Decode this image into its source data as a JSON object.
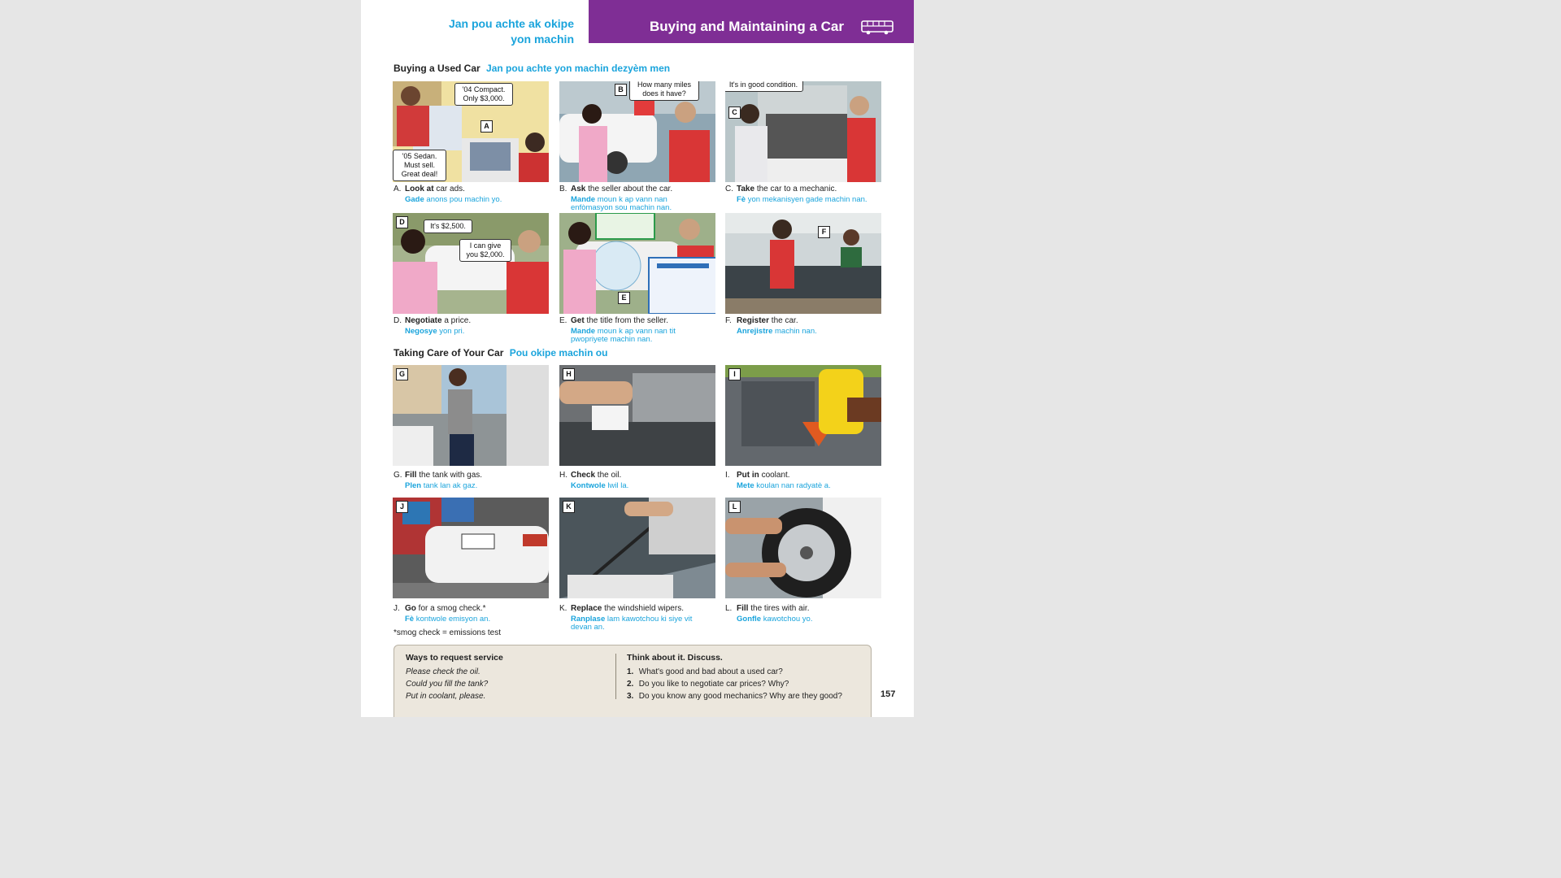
{
  "header": {
    "ht_title_1": "Jan pou achte ak okipe",
    "ht_title_2": "yon machin",
    "title": "Buying and Maintaining a Car"
  },
  "sections": [
    {
      "title": "Buying a Used Car",
      "ht": "Jan pou achte yon machin dezyèm men"
    },
    {
      "title": "Taking Care of Your Car",
      "ht": "Pou okipe machin ou"
    }
  ],
  "items": [
    {
      "letter": "A",
      "verb": "Look at",
      "rest": "car ads.",
      "ht_verb": "Gade",
      "ht_rest": "anons pou machin yo.",
      "bubbles": [
        "'04 Compact. Only $3,000.",
        "'05 Sedan. Must sell. Great deal!"
      ]
    },
    {
      "letter": "B",
      "verb": "Ask",
      "rest": "the seller about the car.",
      "ht_verb": "Mande",
      "ht_rest": "moun k ap vann nan enfòmasyon sou machin nan.",
      "bubbles": [
        "How many miles does it have?"
      ]
    },
    {
      "letter": "C",
      "verb": "Take",
      "rest": "the car to a mechanic.",
      "ht_verb": "Fè",
      "ht_rest": "yon mekanisyen gade machin nan.",
      "bubbles": [
        "It's in good condition."
      ]
    },
    {
      "letter": "D",
      "verb": "Negotiate",
      "rest": "a price.",
      "ht_verb": "Negosye",
      "ht_rest": "yon pri.",
      "bubbles": [
        "It's $2,500.",
        "I can give you $2,000."
      ]
    },
    {
      "letter": "E",
      "verb": "Get",
      "rest": "the title from the seller.",
      "ht_verb": "Mande",
      "ht_rest": "moun k ap vann nan tit pwopriyete machin nan.",
      "bubbles": []
    },
    {
      "letter": "F",
      "verb": "Register",
      "rest": "the car.",
      "ht_verb": "Anrejistre",
      "ht_rest": "machin nan.",
      "bubbles": []
    },
    {
      "letter": "G",
      "verb": "Fill",
      "rest": "the tank with gas.",
      "ht_verb": "Plen",
      "ht_rest": "tank lan ak gaz.",
      "bubbles": []
    },
    {
      "letter": "H",
      "verb": "Check",
      "rest": "the oil.",
      "ht_verb": "Kontwole",
      "ht_rest": "lwil la.",
      "bubbles": []
    },
    {
      "letter": "I",
      "verb": "Put in",
      "rest": "coolant.",
      "ht_verb": "Mete",
      "ht_rest": "koulan nan radyatè a.",
      "bubbles": []
    },
    {
      "letter": "J",
      "verb": "Go",
      "rest": "for a smog check.*",
      "ht_verb": "Fè",
      "ht_rest": "kontwole emisyon an.",
      "bubbles": []
    },
    {
      "letter": "K",
      "verb": "Replace",
      "rest": "the windshield wipers.",
      "ht_verb": "Ranplase",
      "ht_rest": "lam kawotchou ki siye vit devan an.",
      "bubbles": []
    },
    {
      "letter": "L",
      "verb": "Fill",
      "rest": "the tires with air.",
      "ht_verb": "Gonfle",
      "ht_rest": "kawotchou yo.",
      "bubbles": []
    }
  ],
  "footnote": "*smog check = emissions test",
  "box": {
    "left_title": "Ways to request service",
    "left_lines": [
      "Please check the oil.",
      "Could you fill the tank?",
      "Put in coolant, please."
    ],
    "right_title": "Think about it. Discuss.",
    "questions": [
      {
        "n": "1.",
        "text": "What's good and bad about a used car?"
      },
      {
        "n": "2.",
        "text": "Do you like to negotiate car prices? Why?"
      },
      {
        "n": "3.",
        "text": "Do you know any good mechanics? Why are they good?"
      }
    ]
  },
  "page_number": "157",
  "colors": {
    "purple": "#7f2e95",
    "cyan": "#1aa4dc"
  }
}
